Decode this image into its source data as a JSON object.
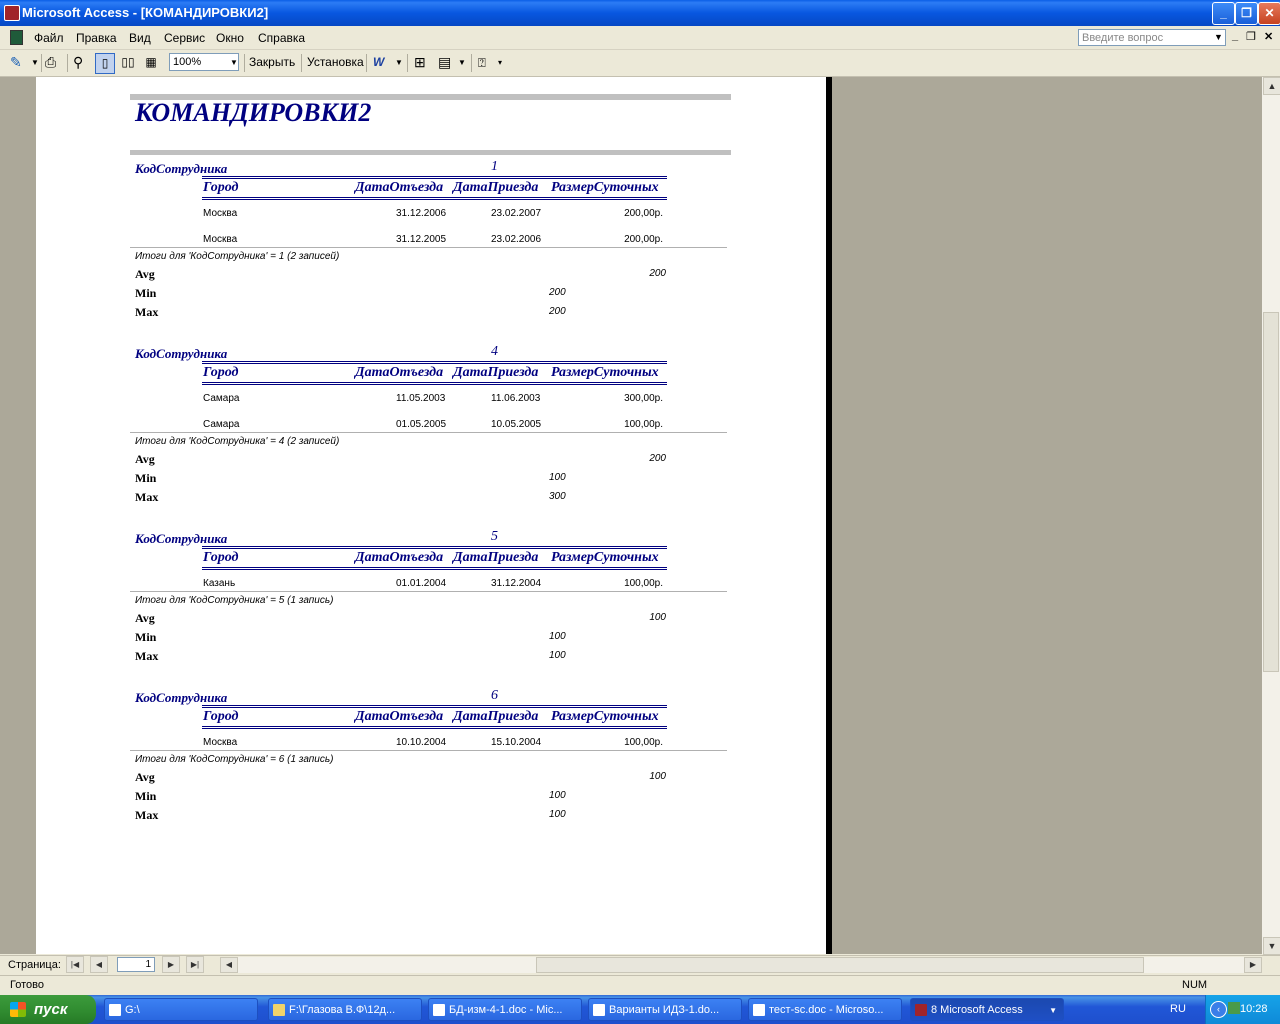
{
  "window": {
    "title": "Microsoft Access - [КОМАНДИРОВКИ2]",
    "min": "_",
    "max": "❐",
    "close": "✕"
  },
  "menu": {
    "items": [
      "Файл",
      "Правка",
      "Вид",
      "Сервис",
      "Окно",
      "Справка"
    ],
    "ask_placeholder": "Введите вопрос"
  },
  "toolbar": {
    "zoom": "100%",
    "close_label": "Закрыть",
    "setup_label": "Установка"
  },
  "report": {
    "title": "КОМАНДИРОВКИ2",
    "group_label": "КодСотрудника",
    "headers": [
      "Город",
      "ДатаОтъезда",
      "ДатаПриезда",
      "РазмерСуточных"
    ],
    "stat_labels": [
      "Avg",
      "Min",
      "Max"
    ],
    "groups": [
      {
        "id": "1",
        "rows": [
          [
            "Москва",
            "31.12.2006",
            "23.02.2007",
            "200,00р."
          ],
          [
            "Москва",
            "31.12.2005",
            "23.02.2006",
            "200,00р."
          ]
        ],
        "summary": "Итоги для 'КодСотрудника' =  1 (2 записей)",
        "avg": "200",
        "min": "200",
        "max": "200"
      },
      {
        "id": "4",
        "rows": [
          [
            "Самара",
            "11.05.2003",
            "11.06.2003",
            "300,00р."
          ],
          [
            "Самара",
            "01.05.2005",
            "10.05.2005",
            "100,00р."
          ]
        ],
        "summary": "Итоги для 'КодСотрудника' =  4 (2 записей)",
        "avg": "200",
        "min": "100",
        "max": "300"
      },
      {
        "id": "5",
        "rows": [
          [
            "Казань",
            "01.01.2004",
            "31.12.2004",
            "100,00р."
          ]
        ],
        "summary": "Итоги для 'КодСотрудника' =  5 (1 запись)",
        "avg": "100",
        "min": "100",
        "max": "100"
      },
      {
        "id": "6",
        "rows": [
          [
            "Москва",
            "10.10.2004",
            "15.10.2004",
            "100,00р."
          ]
        ],
        "summary": "Итоги для 'КодСотрудника' =  6 (1 запись)",
        "avg": "100",
        "min": "100",
        "max": "100"
      }
    ]
  },
  "nav": {
    "page_label": "Страница:",
    "page_value": "1"
  },
  "status": {
    "ready": "Готово",
    "num": "NUM"
  },
  "taskbar": {
    "start": "пуск",
    "tasks": [
      "G:\\",
      "F:\\Глазова В.Ф\\12д...",
      "БД-изм-4-1.doc - Mic...",
      "Варианты ИДЗ-1.do...",
      "тест-sc.doc - Microso...",
      "8 Microsoft Access"
    ],
    "lang": "RU",
    "time": "10:28"
  }
}
